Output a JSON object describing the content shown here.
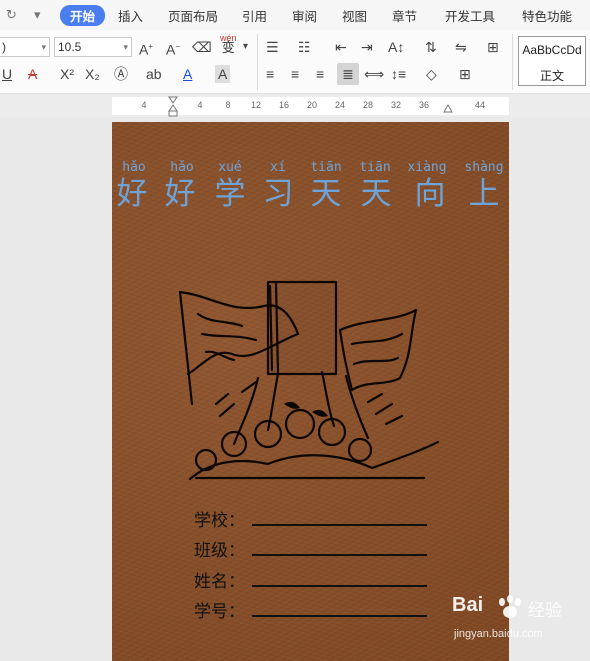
{
  "menu": {
    "tabs": [
      {
        "label": "开始",
        "active": true
      },
      {
        "label": "插入"
      },
      {
        "label": "页面布局"
      },
      {
        "label": "引用"
      },
      {
        "label": "审阅"
      },
      {
        "label": "视图"
      },
      {
        "label": "章节"
      },
      {
        "label": "开发工具"
      },
      {
        "label": "特色功能"
      }
    ],
    "undo_icon": "redo-icon",
    "more_icon": "chevron-down-icon"
  },
  "toolbar": {
    "font_name_value": ")",
    "font_size_value": "10.5",
    "wen_glyph_top": "wén",
    "wen_glyph_bottom": "变",
    "style_preview": "AaBbCcDd",
    "style_name": "正文"
  },
  "ruler": {
    "ticks": [
      "4",
      "4",
      "8",
      "12",
      "16",
      "20",
      "24",
      "28",
      "32",
      "36",
      "44"
    ]
  },
  "cover": {
    "pinyin": [
      "hǎo",
      "hǎo",
      "xué",
      "xí",
      "tiān",
      "tiān",
      "xiàng",
      "shàng"
    ],
    "hanzi": [
      "好",
      "好",
      "学",
      "习",
      "天",
      "天",
      "向",
      "上"
    ],
    "fields": [
      {
        "label": "学校："
      },
      {
        "label": "班级："
      },
      {
        "label": "姓名："
      },
      {
        "label": "学号："
      }
    ],
    "text_color": "#6ea3d8",
    "background_color": "#8a4e26"
  },
  "watermark": {
    "brand": "Bai",
    "brand_suffix": "经验",
    "url": "jingyan.baidu.com"
  }
}
